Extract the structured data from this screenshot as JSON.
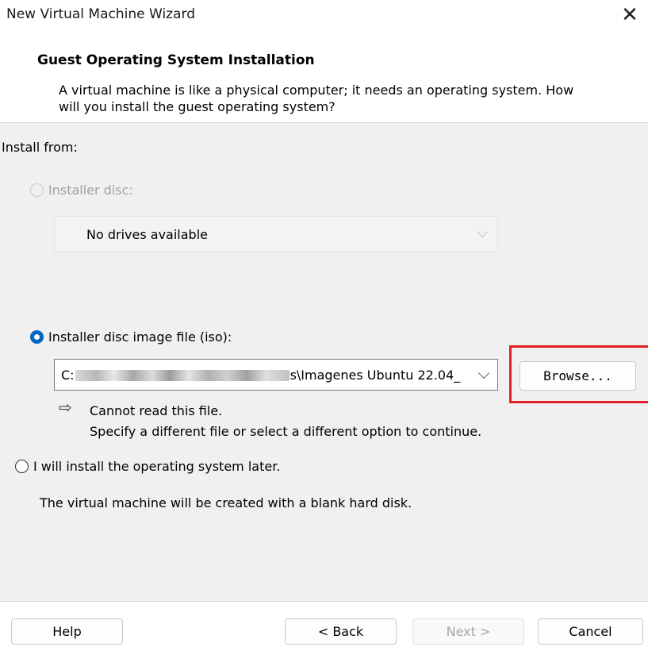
{
  "window": {
    "title": "New Virtual Machine Wizard",
    "close_label": "✕"
  },
  "header": {
    "heading": "Guest Operating System Installation",
    "description": "A virtual machine is like a physical computer; it needs an operating system. How will you install the guest operating system?"
  },
  "install_from": {
    "label": "Install from:",
    "installer_disc": {
      "label": "Installer disc:",
      "selected": false,
      "enabled": false,
      "dropdown_value": "No drives available"
    },
    "iso": {
      "label": "Installer disc image file (iso):",
      "selected": true,
      "path_prefix": "C:",
      "path_suffix": "s\\Imagenes Ubuntu 22.04_",
      "browse_label": "Browse...",
      "warning_title": "Cannot read this file.",
      "warning_detail": "Specify a different file or select a different option to continue."
    },
    "later": {
      "label": "I will install the operating system later.",
      "selected": false,
      "description": "The virtual machine will be created with a blank hard disk."
    }
  },
  "footer": {
    "help_label": "Help",
    "back_label": "< Back",
    "next_label": "Next >",
    "cancel_label": "Cancel"
  },
  "colors": {
    "accent": "#0067c0",
    "highlight": "#e21d25",
    "panel_bg": "#f0f0f0"
  }
}
